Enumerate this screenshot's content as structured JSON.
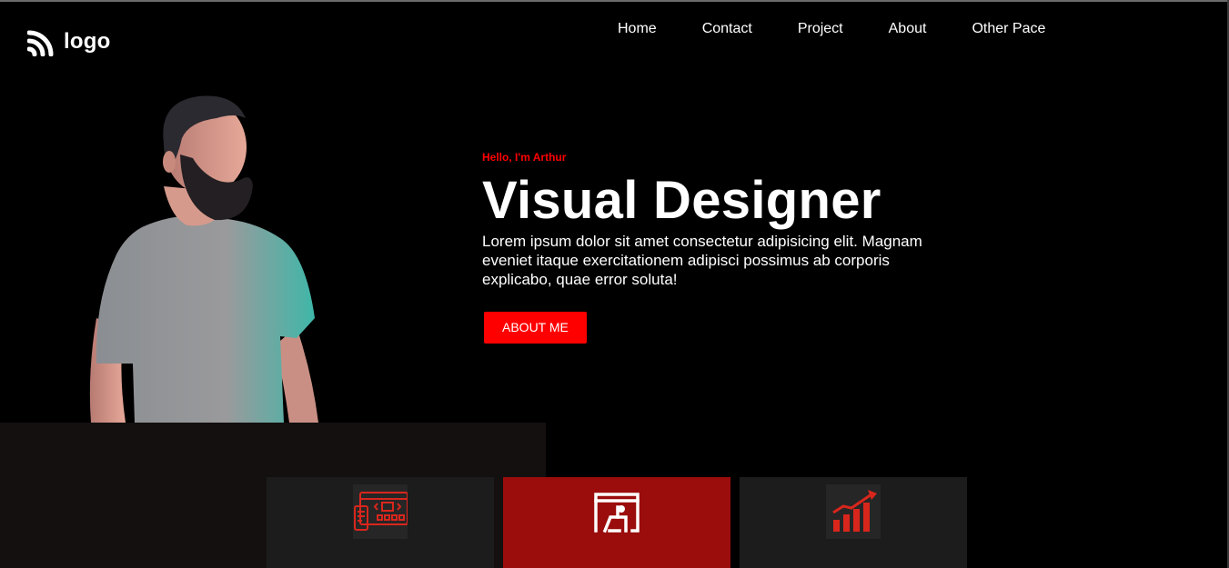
{
  "brand": {
    "logo_text": "logo"
  },
  "nav": {
    "items": [
      "Home",
      "Contact",
      "Project",
      "About",
      "Other Pace"
    ]
  },
  "hero": {
    "greeting": "Hello, I'm Arthur",
    "title": "Visual Designer",
    "description": "Lorem ipsum dolor sit amet consectetur adipisicing elit. Magnam eveniet itaque exercitationem adipisci possimus ab corporis explicabo, quae error soluta!",
    "cta_label": "ABOUT ME"
  },
  "colors": {
    "accent": "#ff0000",
    "active_card": "#9b0c0c",
    "card_bg": "#1c1c1c",
    "panel_bg": "#141010",
    "icon_red": "#d9261c"
  },
  "cards": [
    {
      "icon": "web-design-icon",
      "active": false
    },
    {
      "icon": "presentation-icon",
      "active": true
    },
    {
      "icon": "growth-chart-icon",
      "active": false
    }
  ]
}
